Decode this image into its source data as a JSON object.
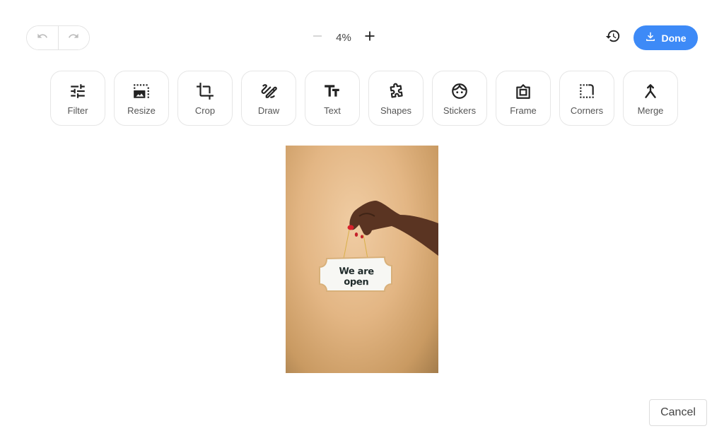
{
  "header": {
    "undo_icon": "undo-icon",
    "redo_icon": "redo-icon",
    "zoom": {
      "minus_icon": "minus-icon",
      "value": "4%",
      "plus_icon": "plus-icon"
    },
    "revert_icon": "history-icon",
    "done": {
      "label": "Done",
      "icon": "download-icon",
      "color": "#3d8af7"
    }
  },
  "tools": [
    {
      "label": "Filter",
      "icon": "sliders-icon"
    },
    {
      "label": "Resize",
      "icon": "resize-icon"
    },
    {
      "label": "Crop",
      "icon": "crop-icon"
    },
    {
      "label": "Draw",
      "icon": "draw-icon"
    },
    {
      "label": "Text",
      "icon": "text-icon"
    },
    {
      "label": "Shapes",
      "icon": "puzzle-shape-icon"
    },
    {
      "label": "Stickers",
      "icon": "face-sticker-icon"
    },
    {
      "label": "Frame",
      "icon": "frame-icon"
    },
    {
      "label": "Corners",
      "icon": "corners-icon"
    },
    {
      "label": "Merge",
      "icon": "merge-icon"
    }
  ],
  "canvas": {
    "image_description": "Hand holding a sign on a beige background",
    "sign_text": "We are open"
  },
  "footer": {
    "cancel_label": "Cancel"
  }
}
